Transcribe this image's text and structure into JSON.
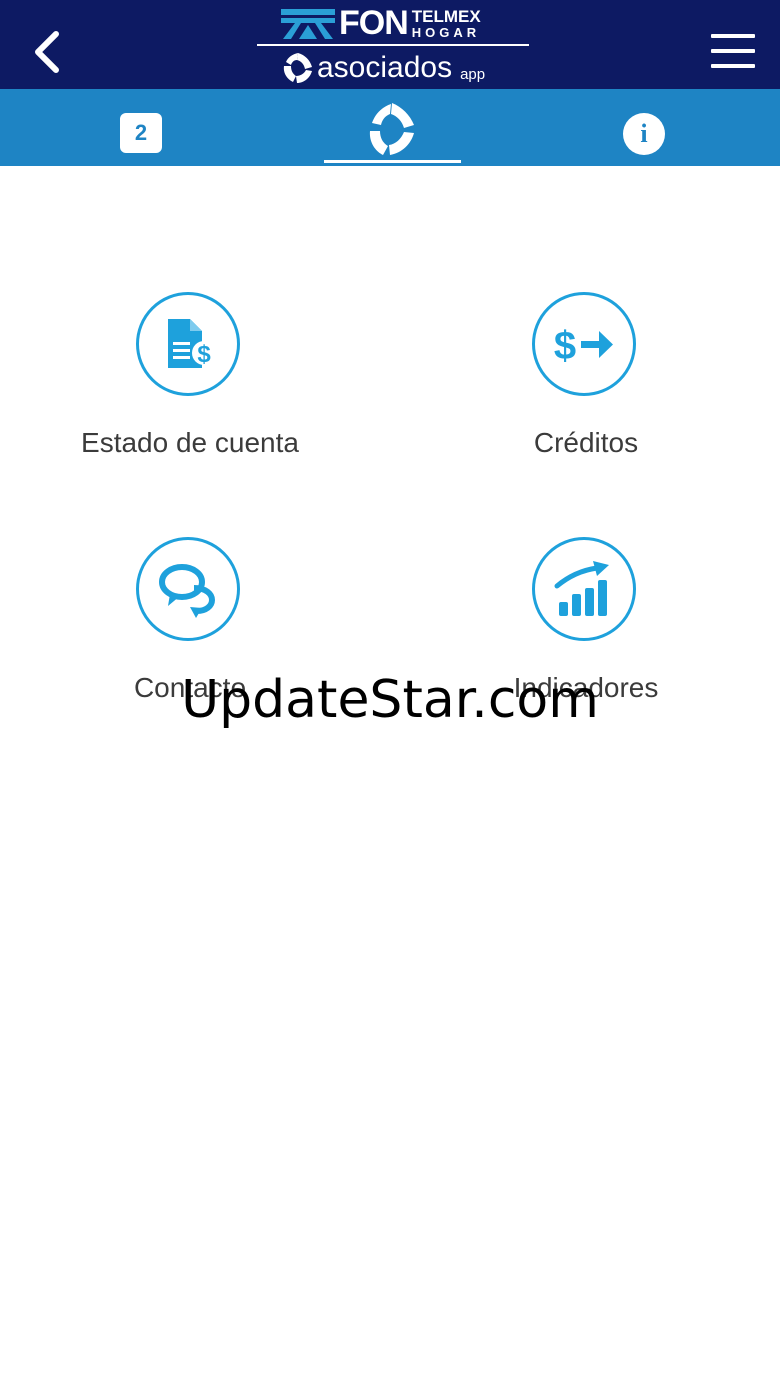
{
  "header": {
    "brand_fon": "FON",
    "brand_telmex": "TELMEX",
    "brand_hogar": "HOGAR",
    "app_name": "asociados",
    "app_suffix": "app",
    "background_color": "#0d1a63"
  },
  "tabs": {
    "badge_label": "2",
    "info_label": "i",
    "active_tab": "home",
    "background_color": "#1e84c4"
  },
  "menu": {
    "accent_color": "#1ea1dc",
    "items": [
      {
        "label": "Estado de cuenta",
        "icon": "document-money-icon"
      },
      {
        "label": "Créditos",
        "icon": "dollar-arrow-icon"
      },
      {
        "label": "Contacto",
        "icon": "chat-bubbles-icon"
      },
      {
        "label": "Indicadores",
        "icon": "bar-chart-growth-icon"
      }
    ]
  },
  "watermark": {
    "text": "UpdateStar.com"
  }
}
